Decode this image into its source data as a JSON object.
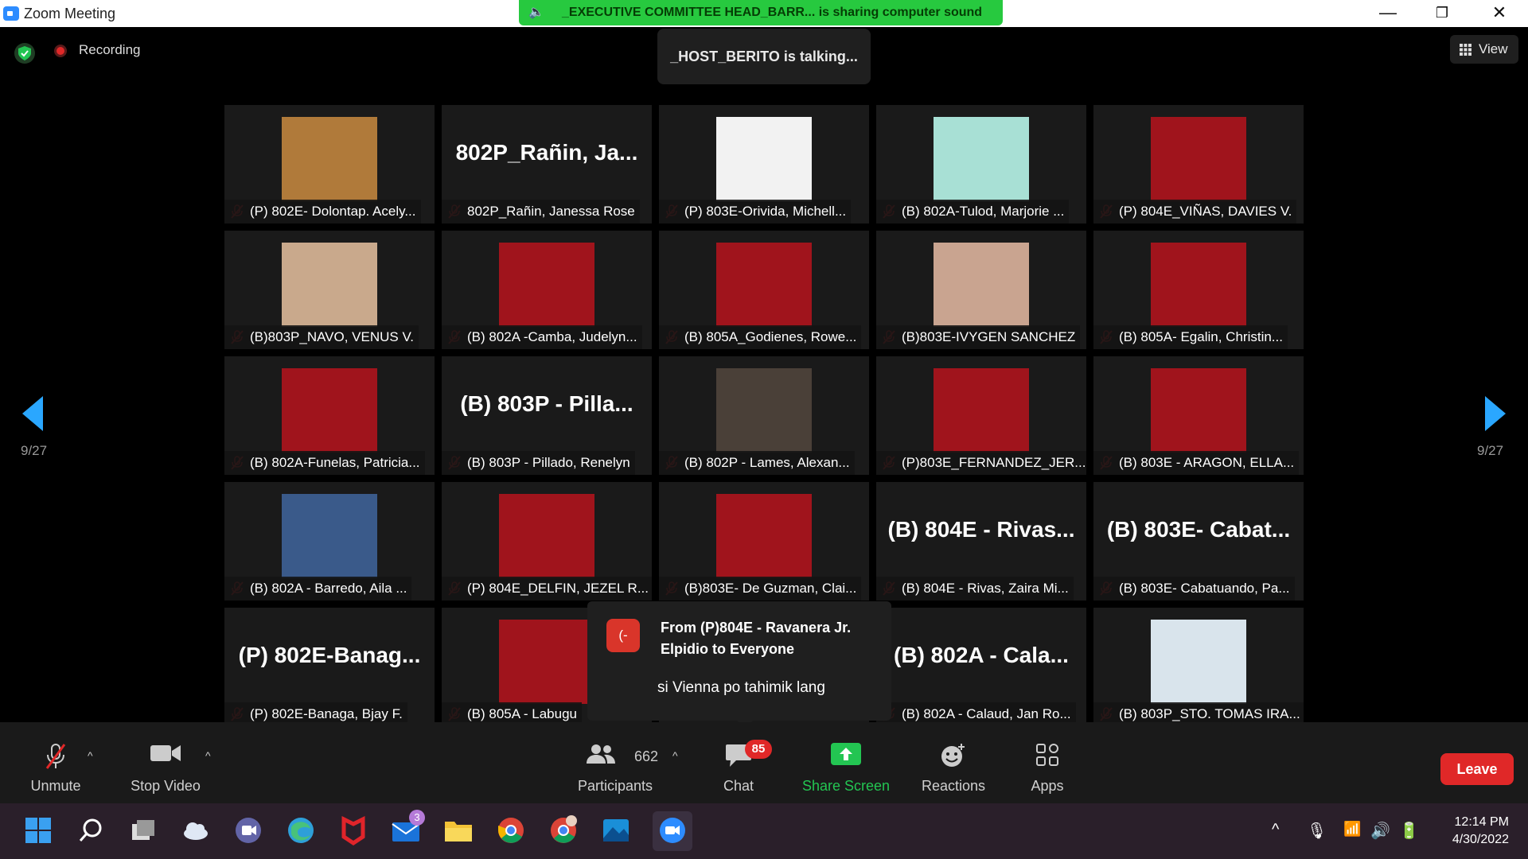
{
  "window": {
    "app_title": "Zoom Meeting",
    "minimize": "—",
    "maximize": "❐",
    "close": "✕"
  },
  "share_banner": {
    "text": "_EXECUTIVE COMMITTEE HEAD_BARR... is sharing computer sound"
  },
  "recording": {
    "label": "Recording"
  },
  "talking": {
    "text": "_HOST_BERITO is talking..."
  },
  "view": {
    "label": "View"
  },
  "pagination": {
    "left": "9/27",
    "right": "9/27"
  },
  "tiles": [
    {
      "name": "(P) 802E- Dolontap. Acely...",
      "big": "",
      "photo": "#b07a3a"
    },
    {
      "name": "802P_Rañin, Janessa Rose",
      "big": "802P_Rañin, Ja...",
      "photo": ""
    },
    {
      "name": "(P) 803E-Orivida, Michell...",
      "big": "",
      "photo": "#f2f2f2"
    },
    {
      "name": "(B) 802A-Tulod, Marjorie ...",
      "big": "",
      "photo": "#a8e0d5"
    },
    {
      "name": "(P) 804E_VIÑAS, DAVIES V.",
      "big": "",
      "photo": "#a0141c"
    },
    {
      "name": "(B)803P_NAVO, VENUS V.",
      "big": "",
      "photo": "#c9a98c"
    },
    {
      "name": "(B) 802A -Camba, Judelyn...",
      "big": "",
      "photo": "#a0141c"
    },
    {
      "name": "(B) 805A_Godienes, Rowe...",
      "big": "",
      "photo": "#a0141c"
    },
    {
      "name": "(B)803E-IVYGEN SANCHEZ",
      "big": "",
      "photo": "#c9a490"
    },
    {
      "name": "(B) 805A- Egalin, Christin...",
      "big": "",
      "photo": "#a0141c"
    },
    {
      "name": "(B) 802A-Funelas, Patricia...",
      "big": "",
      "photo": "#a0141c"
    },
    {
      "name": "(B) 803P - Pillado, Renelyn",
      "big": "(B) 803P - Pilla...",
      "photo": ""
    },
    {
      "name": "(B) 802P - Lames, Alexan...",
      "big": "",
      "photo": "#4a4038"
    },
    {
      "name": "(P)803E_FERNANDEZ_JER...",
      "big": "",
      "photo": "#a0141c"
    },
    {
      "name": "(B) 803E - ARAGON, ELLA...",
      "big": "",
      "photo": "#a0141c"
    },
    {
      "name": "(B) 802A - Barredo, Aila ...",
      "big": "",
      "photo": "#3a5a8a"
    },
    {
      "name": "(P) 804E_DELFIN, JEZEL R...",
      "big": "",
      "photo": "#a0141c"
    },
    {
      "name": "(B)803E- De Guzman, Clai...",
      "big": "",
      "photo": "#a0141c"
    },
    {
      "name": "(B) 804E - Rivas, Zaira Mi...",
      "big": "(B) 804E - Rivas...",
      "photo": ""
    },
    {
      "name": "(B) 803E- Cabatuando, Pa...",
      "big": "(B) 803E- Cabat...",
      "photo": ""
    },
    {
      "name": "(P) 802E-Banaga, Bjay F.",
      "big": "(P) 802E-Banag...",
      "photo": ""
    },
    {
      "name": "(B) 805A - Labugu",
      "big": "",
      "photo": "#a0141c"
    },
    {
      "name": "",
      "big": "",
      "photo": ""
    },
    {
      "name": "(B) 802A - Calaud, Jan Ro...",
      "big": "(B) 802A - Cala...",
      "photo": ""
    },
    {
      "name": "(B) 803P_STO. TOMAS IRA...",
      "big": "",
      "photo": "#d9e4ec"
    }
  ],
  "chat_popup": {
    "avatar": "(-",
    "from": "From (P)804E - Ravanera Jr. Elpidio to Everyone",
    "message": "si Vienna po tahimik lang"
  },
  "toolbar": {
    "unmute": "Unmute",
    "stop_video": "Stop Video",
    "participants": "Participants",
    "participants_count": "662",
    "chat": "Chat",
    "chat_badge": "85",
    "share_screen": "Share Screen",
    "reactions": "Reactions",
    "apps": "Apps",
    "leave": "Leave"
  },
  "taskbar": {
    "mail_badge": "3",
    "time": "12:14 PM",
    "date": "4/30/2022"
  },
  "colors": {
    "accent": "#2aa7ff",
    "share_green": "#27c93f",
    "leave_red": "#e02828"
  }
}
